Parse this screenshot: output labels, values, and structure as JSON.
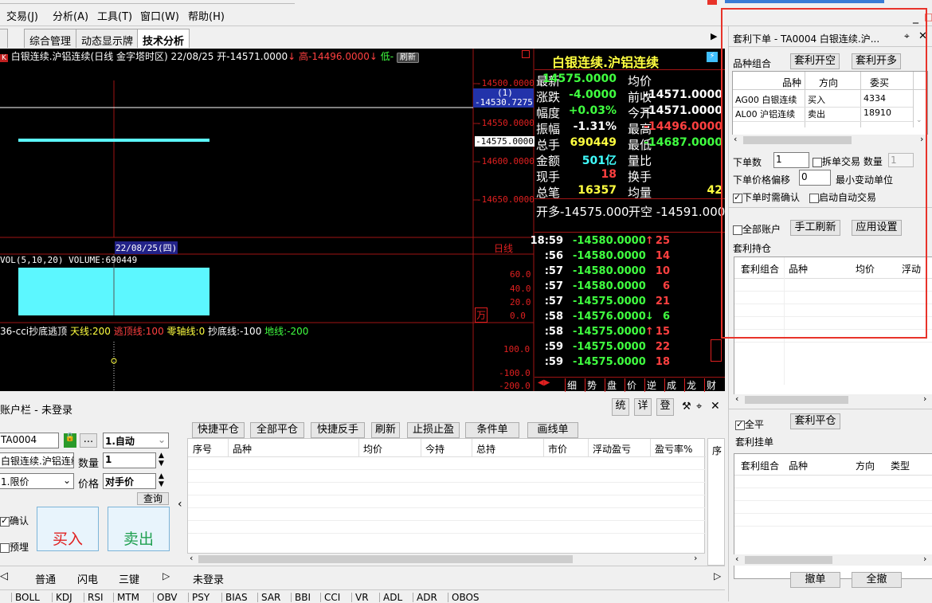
{
  "menu": {
    "trade": "交易(J)",
    "analysis": "分析(A)",
    "tools": "工具(T)",
    "window": "窗口(W)",
    "help": "帮助(H)"
  },
  "tabs": [
    "综合管理",
    "动态显示牌",
    "技术分析"
  ],
  "chart": {
    "info_bar": "白银连续.沪铝连续(日线 金字塔时区) 22/08/25 开-14571.0000",
    "info_high": "高-14496.0000",
    "info_low": "低-",
    "refresh_label": "刷新",
    "price_ticks": [
      "-14500.0000",
      "-14530.7275",
      "-14550.0000",
      "-14575.0000",
      "-14600.0000",
      "-14650.0000"
    ],
    "tooltip_index": "(1)",
    "date_label": "22/08/25(四)",
    "period_label": "日线",
    "vol_label": "VOL(5,10,20) VOLUME:690449",
    "vol_ticks": [
      "60.0",
      "40.0",
      "20.0",
      "0.0"
    ],
    "vol_unit": "万",
    "cci_name": "36-cci抄底逃顶",
    "cci_legend": [
      {
        "text": "天线:200",
        "color": "#ffff40"
      },
      {
        "text": "逃顶线:100",
        "color": "#ff4040"
      },
      {
        "text": "零轴线:0",
        "color": "#ffff40"
      },
      {
        "text": "抄底线:-100",
        "color": "#ffffff"
      },
      {
        "text": "地线:-200",
        "color": "#40ff40"
      }
    ],
    "cci_ticks": [
      "100.0",
      "-100.0",
      "-200.0"
    ]
  },
  "quote": {
    "title": "白银连续.沪铝连续",
    "rows": [
      {
        "l1": "最新",
        "v1": "14575.0000",
        "c1": "#40ff40",
        "l2": "均价",
        "v2": "",
        "c2": "#fff"
      },
      {
        "l1": "涨跌",
        "v1": "-4.0000",
        "c1": "#40ff40",
        "l2": "前收",
        "v2": "-14571.0000",
        "c2": "#fff"
      },
      {
        "l1": "幅度",
        "v1": "+0.03%",
        "c1": "#40ff40",
        "l2": "今开",
        "v2": "-14571.0000",
        "c2": "#fff"
      },
      {
        "l1": "振幅",
        "v1": "-1.31%",
        "c1": "#fff",
        "l2": "最高",
        "v2": "-14496.0000",
        "c2": "#ff4040"
      },
      {
        "l1": "总手",
        "v1": "690449",
        "c1": "#ffff40",
        "l2": "最低",
        "v2": "-14687.0000",
        "c2": "#40ff40"
      },
      {
        "l1": "金额",
        "v1": "501亿",
        "c1": "#40ffff",
        "l2": "量比",
        "v2": "",
        "c2": "#fff"
      },
      {
        "l1": "现手",
        "v1": "18",
        "c1": "#ff4040",
        "l2": "换手",
        "v2": "",
        "c2": "#fff"
      },
      {
        "l1": "总笔",
        "v1": "16357",
        "c1": "#ffff40",
        "l2": "均量",
        "v2": "42",
        "c2": "#ffff40"
      }
    ],
    "open_pos": "开多-14575.000",
    "open_short": "开空 -14591.000",
    "ticks": [
      {
        "t": "18:59",
        "p": "-14580.0000",
        "a": "↑",
        "v": "25",
        "c": "#ff4040"
      },
      {
        "t": ":56",
        "p": "-14580.0000",
        "a": "",
        "v": "14",
        "c": "#ff4040"
      },
      {
        "t": ":57",
        "p": "-14580.0000",
        "a": "",
        "v": "10",
        "c": "#ff4040"
      },
      {
        "t": ":57",
        "p": "-14580.0000",
        "a": "",
        "v": "6",
        "c": "#ff4040"
      },
      {
        "t": ":57",
        "p": "-14575.0000",
        "a": "",
        "v": "21",
        "c": "#ff4040"
      },
      {
        "t": ":58",
        "p": "-14576.0000",
        "a": "↓",
        "v": "6",
        "c": "#40ff40"
      },
      {
        "t": ":58",
        "p": "-14575.0000",
        "a": "↑",
        "v": "15",
        "c": "#ff4040"
      },
      {
        "t": ":59",
        "p": "-14575.0000",
        "a": "",
        "v": "22",
        "c": "#ff4040"
      },
      {
        "t": ":59",
        "p": "-14575.0000",
        "a": "",
        "v": "18",
        "c": "#ff4040"
      }
    ],
    "bottom_tabs": [
      "细",
      "势",
      "盘",
      "价",
      "逆",
      "成",
      "龙",
      "财"
    ]
  },
  "account": {
    "title": "账户栏 - 未登录",
    "icons": [
      "统",
      "详",
      "登"
    ],
    "code": "TA0004",
    "mode": "1.自动",
    "contract": "白银连续.沪铝连续",
    "qty_label": "数量",
    "qty": "1",
    "order_type": "1.限价",
    "price_label": "价格",
    "price": "对手价",
    "query": "查询",
    "confirm": "确认",
    "preview": "预埋",
    "buy": "买入",
    "sell": "卖出",
    "toolbar": [
      "快捷平仓",
      "全部平仓",
      "快捷反手",
      "刷新",
      "止损止盈",
      "条件单",
      "画线单"
    ],
    "columns": [
      "序号",
      "品种",
      "均价",
      "今持",
      "总持",
      "市价",
      "浮动盈亏",
      "盈亏率%"
    ],
    "side_col": "序",
    "status": "未登录",
    "bottom_tabs": [
      "普通",
      "闪电",
      "三键"
    ]
  },
  "indicators": [
    "BOLL",
    "KDJ",
    "RSI",
    "MTM",
    "OBV",
    "PSY",
    "BIAS",
    "SAR",
    "BBI",
    "CCI",
    "VR",
    "ADL",
    "ADR",
    "OBOS"
  ],
  "rp": {
    "title": "套利下单 - TA0004 白银连续.沪...",
    "combo_label": "品种组合",
    "open_empty": "套利开空",
    "open_long": "套利开多",
    "cols": [
      "品种",
      "方向",
      "委买"
    ],
    "legs": [
      {
        "c": "AG00 白银连续",
        "d": "买入",
        "p": "4334"
      },
      {
        "c": "AL00 沪铝连续",
        "d": "卖出",
        "p": "18910"
      }
    ],
    "lots_label": "下单数",
    "lots": "1",
    "split_label": "拆单交易 数量",
    "split_qty": "1",
    "offset_label": "下单价格偏移",
    "offset": "0",
    "min_unit": "最小变动单位",
    "confirm_label": "下单时需确认",
    "auto_label": "启动自动交易",
    "all_acct": "全部账户",
    "manual_refresh": "手工刷新",
    "apply": "应用设置",
    "pos_title": "套利持仓",
    "pos_cols": [
      "套利组合",
      "品种",
      "均价",
      "浮动"
    ],
    "all_close": "全平",
    "close_btn": "套利平仓",
    "pending_title": "套利挂单",
    "pend_cols": [
      "套利组合",
      "品种",
      "方向",
      "类型"
    ],
    "cancel": "撤单",
    "cancel_all": "全撤"
  },
  "colors": {
    "accent_red": "#e8332a",
    "cyan": "#5cf7ff",
    "chart_bg": "#000000"
  }
}
